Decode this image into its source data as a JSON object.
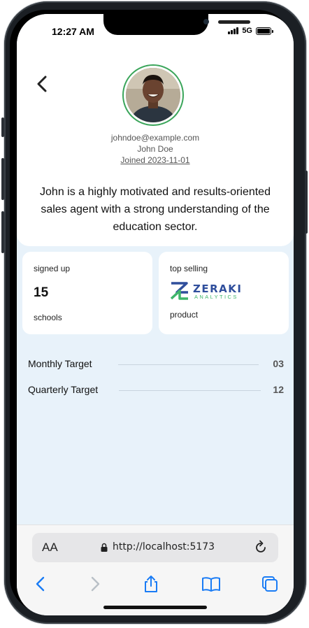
{
  "status_bar": {
    "time": "12:27 AM",
    "network": "5G"
  },
  "profile": {
    "email": "johndoe@example.com",
    "name": "John Doe",
    "joined": "Joined 2023-11-01",
    "bio": "John is a highly motivated and results-oriented sales agent with a strong understanding of the education sector."
  },
  "stats": {
    "signed_up": {
      "label": "signed up",
      "value": "15",
      "unit": "schools"
    },
    "top_selling": {
      "label": "top selling",
      "logo_name": "ZERAKI",
      "logo_sub": "ANALYTICS",
      "unit": "product"
    }
  },
  "targets": [
    {
      "label": "Monthly Target",
      "value": "03"
    },
    {
      "label": "Quarterly Target",
      "value": "12"
    }
  ],
  "browser": {
    "text_size_label": "AA",
    "url": "http://localhost:5173"
  },
  "colors": {
    "accent_green": "#3aa55a",
    "brand_blue": "#2f4e9c",
    "ios_blue": "#1a7cf5",
    "page_bg": "#e8f2fa"
  }
}
